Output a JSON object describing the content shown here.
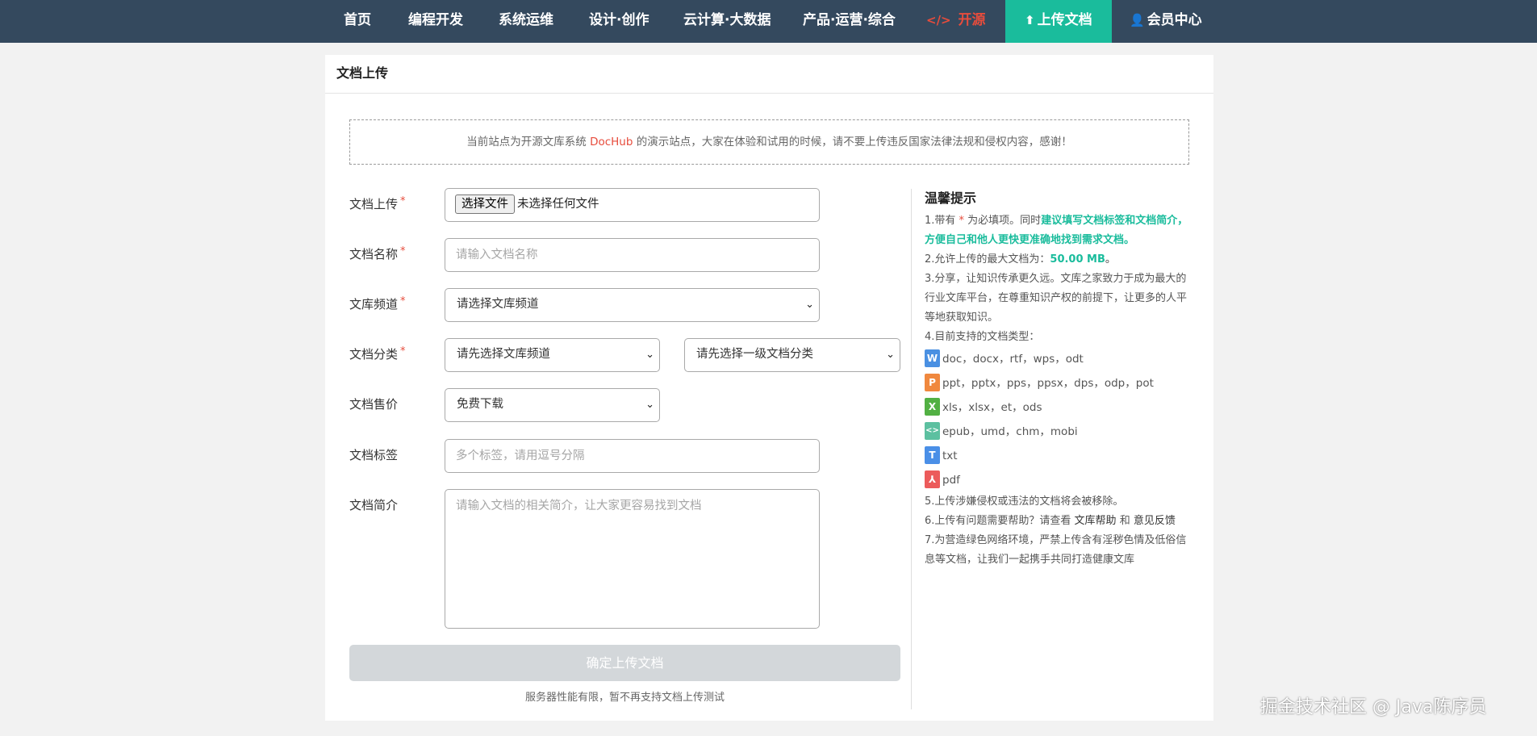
{
  "nav": {
    "items": [
      {
        "label": "首页"
      },
      {
        "label": "编程开发"
      },
      {
        "label": "系统运维"
      },
      {
        "label": "设计·创作"
      },
      {
        "label": "云计算·大数据"
      },
      {
        "label": "产品·运营·综合"
      },
      {
        "label": "开源",
        "icon": "code-icon"
      },
      {
        "label": "上传文档",
        "icon": "upload-icon"
      },
      {
        "label": "会员中心",
        "icon": "user-icon"
      }
    ],
    "colors": {
      "bar": "#34495e",
      "active": "#1abc9c",
      "opensrc": "#e74c3c"
    }
  },
  "page": {
    "title": "文档上传"
  },
  "notice": {
    "prefix": "当前站点为开源文库系统 ",
    "brand": "DocHub",
    "suffix": " 的演示站点，大家在体验和试用的时候，请不要上传违反国家法律法规和侵权内容，感谢！"
  },
  "form": {
    "required_mark": "*",
    "file": {
      "label": "文档上传",
      "button": "选择文件",
      "status": "未选择任何文件"
    },
    "name": {
      "label": "文档名称",
      "placeholder": "请输入文档名称"
    },
    "channel": {
      "label": "文库频道",
      "value": "请选择文库频道"
    },
    "category": {
      "label": "文档分类",
      "value1": "请先选择文库频道",
      "value2": "请先选择一级文档分类"
    },
    "price": {
      "label": "文档售价",
      "value": "免费下载"
    },
    "tags": {
      "label": "文档标签",
      "placeholder": "多个标签，请用逗号分隔"
    },
    "intro": {
      "label": "文档简介",
      "placeholder": "请输入文档的相关简介，让大家更容易找到文档"
    },
    "submit": "确定上传文档",
    "submit_note": "服务器性能有限，暂不再支持文档上传测试"
  },
  "tips": {
    "title": "温馨提示",
    "t1_a": "1.带有 ",
    "t1_star": "*",
    "t1_b": " 为必填项。同时",
    "t1_c": "建议填写文档标签和文档简介，方便自己和他人更快更准确地找到需求文档。",
    "t2_a": "2.允许上传的最大文档为：",
    "t2_b": "50.00 MB",
    "t2_c": "。",
    "t3_a": "3.分享，让知识传承更久远。",
    "t3_b": "文库之家致力于成为最大的行业文库平台，在尊重知识产权的前提下，让更多的人平等地获取知识。",
    "t4": "4.目前支持的文档类型：",
    "types": [
      {
        "icon": "word-doc-icon",
        "letter": "W",
        "color": "#4a90e2",
        "text": "doc，docx，rtf，wps，odt"
      },
      {
        "icon": "ppt-icon",
        "letter": "P",
        "color": "#f0883e",
        "text": "ppt，pptx，pps，ppsx，dps，odp，pot"
      },
      {
        "icon": "excel-icon",
        "letter": "X",
        "color": "#52b043",
        "text": "xls，xlsx，et，ods"
      },
      {
        "icon": "epub-icon",
        "letter": "<>",
        "color": "#5cc0a0",
        "text": "epub，umd，chm，mobi"
      },
      {
        "icon": "txt-icon",
        "letter": "T",
        "color": "#4a8fe7",
        "text": "txt"
      },
      {
        "icon": "pdf-icon",
        "letter": "⅄",
        "color": "#ec5b5b",
        "text": "pdf"
      }
    ],
    "t5": "5.上传涉嫌侵权或违法的文档将会被移除。",
    "t6_a": "6.上传有问题需要帮助？请查看 ",
    "t6_link1": "文库帮助",
    "t6_b": " 和 ",
    "t6_link2": "意见反馈",
    "t7": "7.为营造绿色网络环境，严禁上传含有淫秽色情及低俗信息等文档，让我们一起携手共同打造健康文库"
  },
  "watermark": "掘金技术社区 @ Java陈序员"
}
